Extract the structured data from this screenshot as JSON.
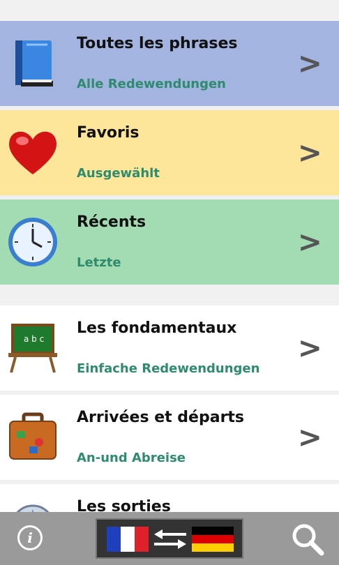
{
  "menu": [
    {
      "title": "Toutes les phrases",
      "subtitle": "Alle Redewendungen",
      "chevron": ">",
      "icon": "book-icon",
      "bg": "#a4b4e0"
    },
    {
      "title": "Favoris",
      "subtitle": "Ausgewählt",
      "chevron": ">",
      "icon": "heart-icon",
      "bg": "#fde59a"
    },
    {
      "title": "Récents",
      "subtitle": "Letzte",
      "chevron": ">",
      "icon": "clock-icon",
      "bg": "#a3dbb3"
    },
    {
      "title": "Les fondamentaux",
      "subtitle": "Einfache Redewendungen",
      "chevron": ">",
      "icon": "chalkboard-icon",
      "bg": "#ffffff"
    },
    {
      "title": "Arrivées et départs",
      "subtitle": "An-und Abreise",
      "chevron": ">",
      "icon": "suitcase-icon",
      "bg": "#ffffff"
    },
    {
      "title": "Les sorties",
      "subtitle": "",
      "chevron": ">",
      "icon": "compass-icon",
      "bg": "#ffffff"
    }
  ],
  "bottom_bar": {
    "info_label": "i",
    "source_lang_icon": "france-flag-icon",
    "target_lang_icon": "germany-flag-icon",
    "swap_icon": "swap-arrows-icon",
    "search_icon": "search-icon"
  },
  "colors": {
    "subtitle": "#2e8b6e",
    "bar": "#9a9a9a"
  }
}
